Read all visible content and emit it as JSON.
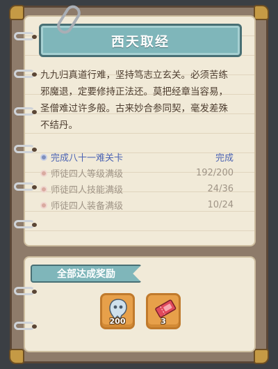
{
  "title": "西天取经",
  "poem": {
    "lines": [
      "九九归真道行难，坚持笃志立玄关。必须苦练",
      "邪魔退，定要修持正法还。莫把经章当容易，",
      "圣僧难过许多般。古来妙合参同契，毫发差殊",
      "不结丹。"
    ]
  },
  "quests": [
    {
      "name": "完成八十一难关卡",
      "value": "完成",
      "status": "done"
    },
    {
      "name": "师徒四人等级满级",
      "value": "192/200",
      "status": "pending"
    },
    {
      "name": "师徒四人技能满级",
      "value": "24/36",
      "status": "pending"
    },
    {
      "name": "师徒四人装备满级",
      "value": "10/24",
      "status": "pending"
    }
  ],
  "reward": {
    "label": "全部达成奖励",
    "items": [
      {
        "icon": "ghost-spirit-icon",
        "count": "200"
      },
      {
        "icon": "ticket-icon",
        "count": "3"
      }
    ]
  },
  "colors": {
    "accent": "#7fb6ba",
    "done": "#4b63b3",
    "pending": "#9f9486",
    "item_bg": "#e7a04a"
  }
}
